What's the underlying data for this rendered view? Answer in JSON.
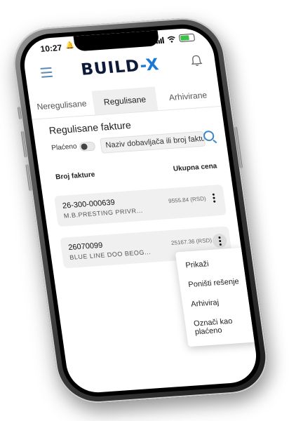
{
  "status_bar": {
    "time": "10:27",
    "bell": "🔔"
  },
  "header": {
    "logo_main": "BUILD",
    "logo_dash": "-",
    "logo_x": "X"
  },
  "tabs": [
    {
      "label": "Neregulisane"
    },
    {
      "label": "Regulisane"
    },
    {
      "label": "Arhivirane"
    }
  ],
  "section": {
    "title": "Regulisane fakture"
  },
  "filter": {
    "paid_label": "Plaćeno",
    "search_placeholder": "Naziv dobavljača ili broj fakture"
  },
  "columns": {
    "left": "Broj fakture",
    "right": "Ukupna cena"
  },
  "invoices": [
    {
      "number": "26-300-000639",
      "supplier": "M.B.PRESTING PRIVR...",
      "amount": "9555.84 (RSD)"
    },
    {
      "number": "26070099",
      "supplier": "BLUE LINE DOO BEOG...",
      "amount": "25167.36 (RSD)"
    }
  ],
  "context_menu": {
    "items": [
      {
        "label": "Prikaži"
      },
      {
        "label": "Poništi rešenje"
      },
      {
        "label": "Arhiviraj"
      },
      {
        "label": "Označi kao plaćeno"
      }
    ]
  }
}
